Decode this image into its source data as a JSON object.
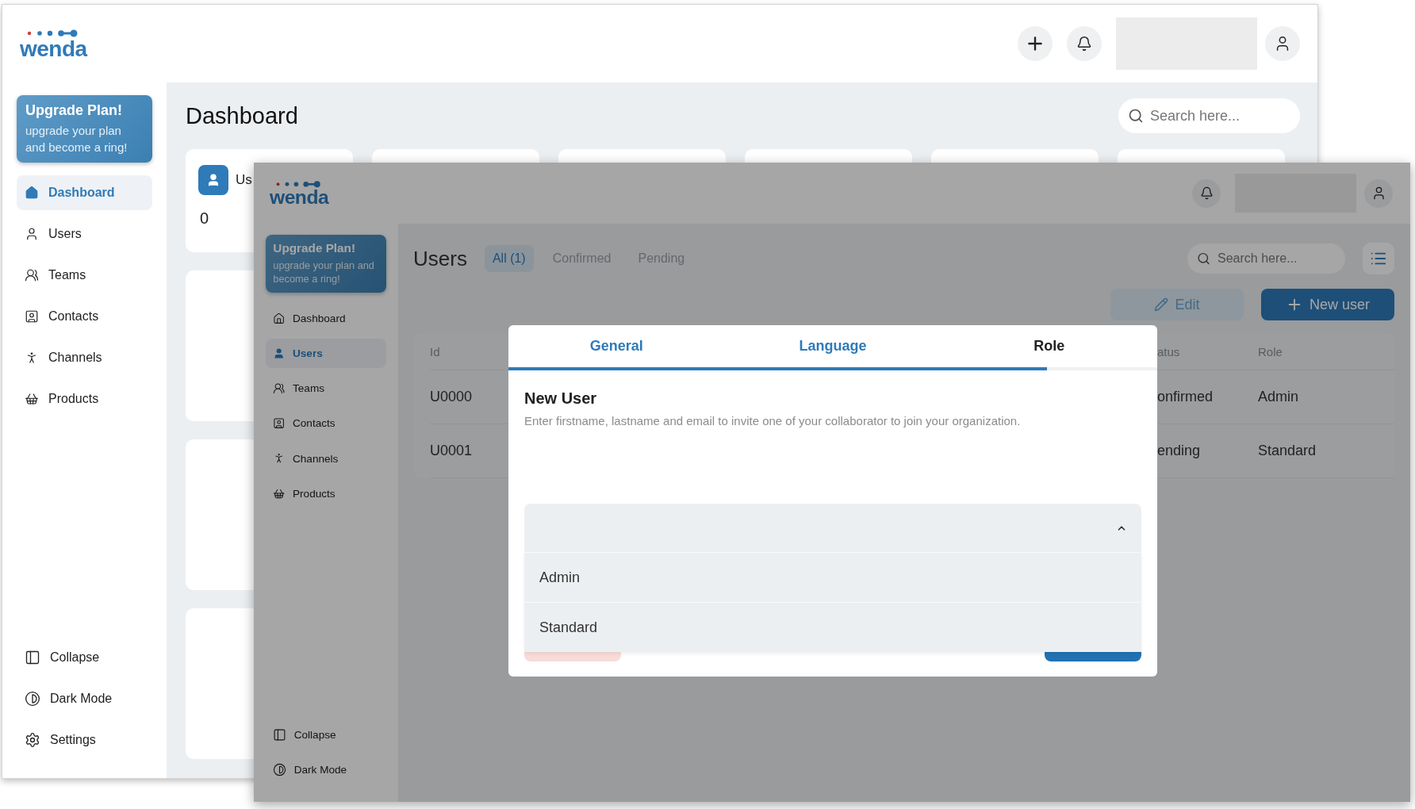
{
  "back_window": {
    "logo": "wenda",
    "sidebar": {
      "promo": {
        "title": "Upgrade Plan!",
        "text": "upgrade your plan and become a ring!"
      },
      "items": [
        {
          "label": "Dashboard",
          "selected": true
        },
        {
          "label": "Users",
          "selected": false
        },
        {
          "label": "Teams",
          "selected": false
        },
        {
          "label": "Contacts",
          "selected": false
        },
        {
          "label": "Channels",
          "selected": false
        },
        {
          "label": "Products",
          "selected": false
        }
      ],
      "footer_items": [
        {
          "label": "Collapse"
        },
        {
          "label": "Dark Mode"
        },
        {
          "label": "Settings"
        }
      ]
    },
    "main": {
      "title": "Dashboard",
      "search": {
        "placeholder": "Search here..."
      },
      "stat_card": {
        "label": "Us",
        "value": "0"
      }
    }
  },
  "front_window": {
    "logo": "wenda",
    "sidebar": {
      "promo": {
        "title": "Upgrade Plan!",
        "text": "upgrade your plan and become a ring!"
      },
      "items": [
        {
          "label": "Dashboard",
          "selected": false
        },
        {
          "label": "Users",
          "selected": true
        },
        {
          "label": "Teams",
          "selected": false
        },
        {
          "label": "Contacts",
          "selected": false
        },
        {
          "label": "Channels",
          "selected": false
        },
        {
          "label": "Products",
          "selected": false
        }
      ],
      "footer_items": [
        {
          "label": "Collapse"
        },
        {
          "label": "Dark Mode"
        }
      ]
    },
    "main": {
      "title": "Users",
      "filters": [
        {
          "label": "All (1)",
          "selected": true
        },
        {
          "label": "Confirmed",
          "selected": false
        },
        {
          "label": "Pending",
          "selected": false
        }
      ],
      "search": {
        "placeholder": "Search here..."
      },
      "buttons": [
        {
          "label": "Edit",
          "kind": "edit"
        },
        {
          "label": "New user",
          "kind": "add"
        }
      ],
      "table": {
        "columns": [
          "Id",
          "atus",
          "Role"
        ],
        "rows": [
          [
            "U0000",
            "onfirmed",
            "Admin"
          ],
          [
            "U0001",
            "ending",
            "Standard"
          ]
        ]
      }
    },
    "dialog": {
      "tabs": [
        {
          "label": "General",
          "selected": false
        },
        {
          "label": "Language",
          "selected": false
        },
        {
          "label": "Role",
          "selected": true
        }
      ],
      "progress": {
        "level": 0.83
      },
      "title": "New User",
      "description": "Enter firstname, lastname and email to invite one of your collaborator to join your organization.",
      "role_select": {
        "expanded": true,
        "options": [
          {
            "label": "Admin"
          },
          {
            "label": "Standard"
          }
        ]
      }
    }
  }
}
